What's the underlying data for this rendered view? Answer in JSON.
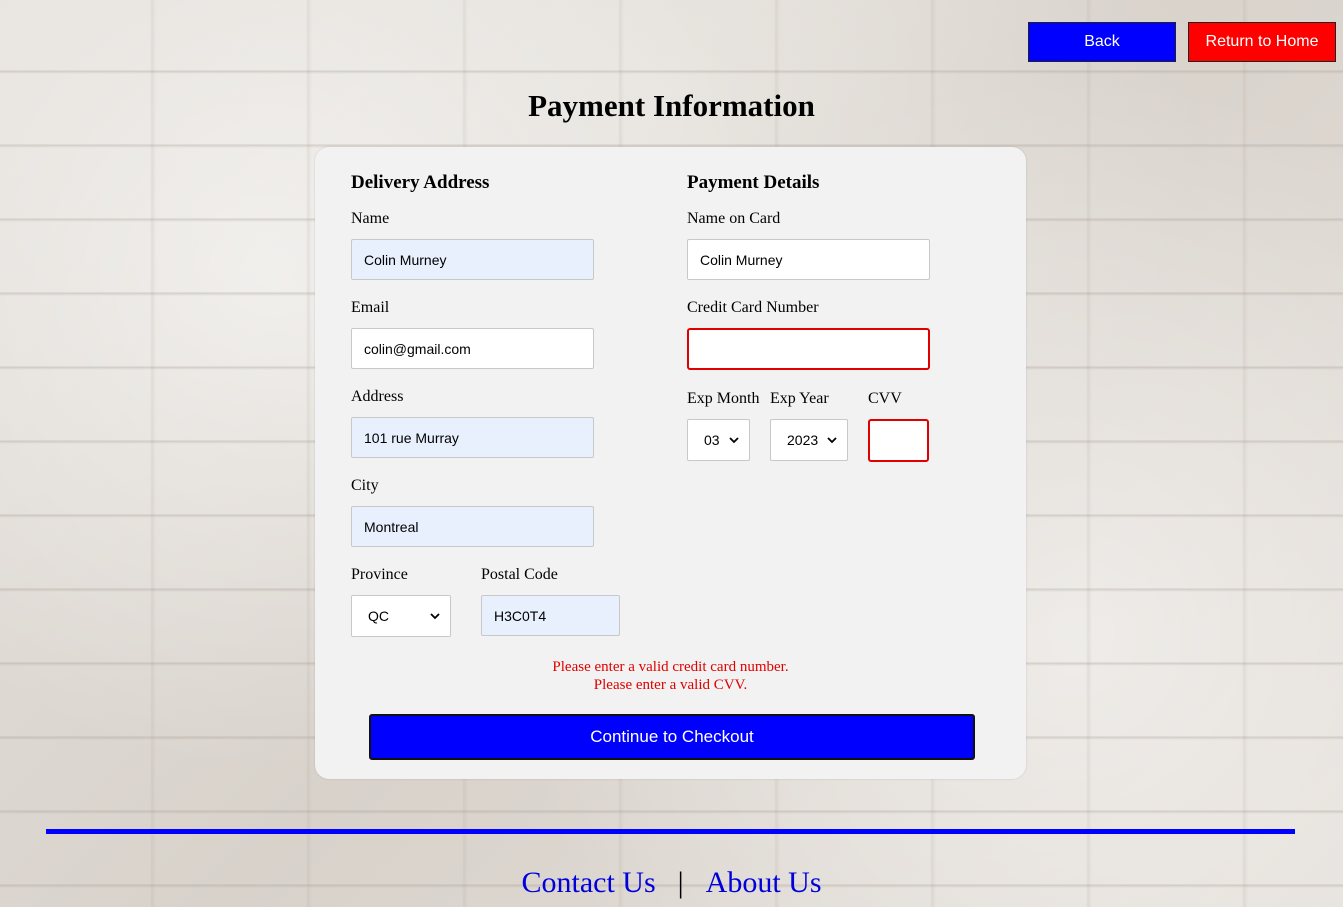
{
  "header": {
    "back_label": "Back",
    "home_label": "Return to Home",
    "title": "Payment Information"
  },
  "delivery": {
    "title": "Delivery Address",
    "name_label": "Name",
    "name_value": "Colin Murney",
    "email_label": "Email",
    "email_value": "colin@gmail.com",
    "address_label": "Address",
    "address_value": "101 rue Murray",
    "city_label": "City",
    "city_value": "Montreal",
    "province_label": "Province",
    "province_value": "QC",
    "postal_label": "Postal Code",
    "postal_value": "H3C0T4"
  },
  "payment": {
    "title": "Payment Details",
    "card_name_label": "Name on Card",
    "card_name_value": "Colin Murney",
    "card_number_label": "Credit Card Number",
    "card_number_value": "",
    "exp_month_label": "Exp Month",
    "exp_month_value": "03",
    "exp_year_label": "Exp Year",
    "exp_year_value": "2023",
    "cvv_label": "CVV",
    "cvv_value": ""
  },
  "errors": {
    "card_error": "Please enter a valid credit card number.",
    "cvv_error": "Please enter a valid CVV."
  },
  "checkout_label": "Continue to Checkout",
  "footer": {
    "contact_label": "Contact Us",
    "separator": "|",
    "about_label": "About Us"
  },
  "colors": {
    "primary_button": "#0000ff",
    "danger_button": "#ff0000",
    "error_text": "#e00000",
    "autofill_bg": "#e8f0fe"
  },
  "icons": {
    "select_arrow": "chevron-down-icon"
  }
}
